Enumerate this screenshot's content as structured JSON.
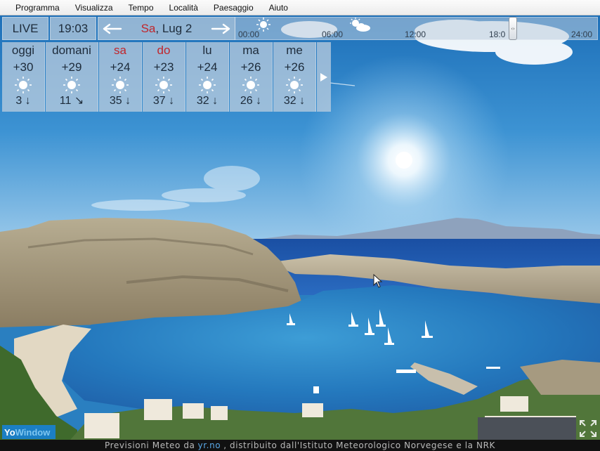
{
  "menu": [
    "Programma",
    "Visualizza",
    "Tempo",
    "Località",
    "Paesaggio",
    "Aiuto"
  ],
  "topbar": {
    "live_label": "LIVE",
    "time": "19:03",
    "date_day": "Sa",
    "date_rest": ", Lug 2"
  },
  "timeline": {
    "labels": [
      "00:00",
      "06:00",
      "12:00",
      "18:0",
      "24:00"
    ],
    "handle_glyph": "‹›"
  },
  "forecast": [
    {
      "day": "oggi",
      "temp": "+30",
      "wind": "3",
      "arrow": "↓",
      "weekend": false
    },
    {
      "day": "domani",
      "temp": "+29",
      "wind": "11",
      "arrow": "↘",
      "weekend": false
    },
    {
      "day": "sa",
      "temp": "+24",
      "wind": "35",
      "arrow": "↓",
      "weekend": true
    },
    {
      "day": "do",
      "temp": "+23",
      "wind": "37",
      "arrow": "↓",
      "weekend": true
    },
    {
      "day": "lu",
      "temp": "+24",
      "wind": "32",
      "arrow": "↓",
      "weekend": false
    },
    {
      "day": "ma",
      "temp": "+26",
      "wind": "26",
      "arrow": "↓",
      "weekend": false
    },
    {
      "day": "me",
      "temp": "+26",
      "wind": "32",
      "arrow": "↓",
      "weekend": false
    }
  ],
  "logo": {
    "part1": "Yo",
    "part2": "Window"
  },
  "footer": {
    "before": "Previsioni Meteo da",
    "link": "yr.no",
    "after": ", distribuito dall'Istituto Meteorologico Norvegese e la NRK"
  },
  "colors": {
    "weekend": "#c0262c",
    "link": "#5aa8e6",
    "panel": "#becede"
  }
}
